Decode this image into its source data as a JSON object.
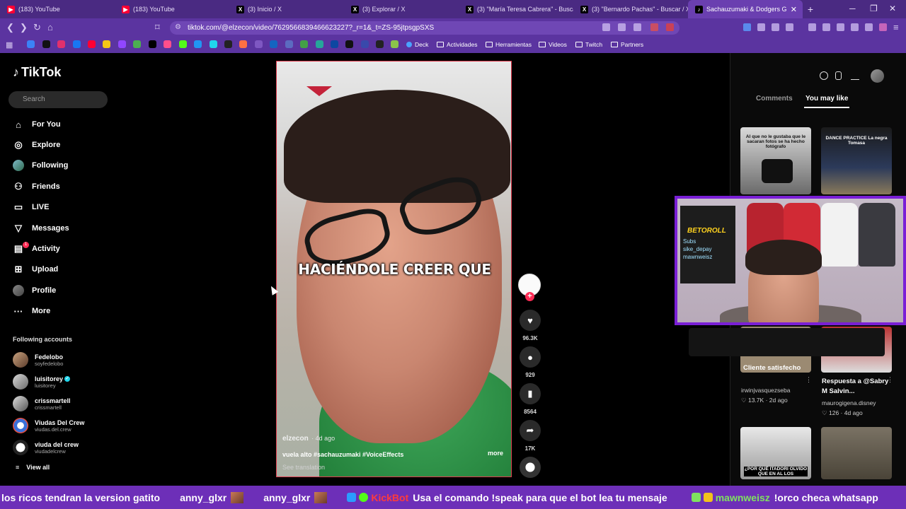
{
  "browser": {
    "tabs": [
      {
        "label": "(183) YouTube",
        "icon": "youtube-icon"
      },
      {
        "label": "(183) YouTube",
        "icon": "youtube-icon"
      },
      {
        "label": "(3) Inicio / X",
        "icon": "x-icon"
      },
      {
        "label": "(3) Explorar / X",
        "icon": "x-icon"
      },
      {
        "label": "(3) \"María Teresa Cabrera\" - Buscar /",
        "icon": "x-icon"
      },
      {
        "label": "(3) \"Bernardo Pachas\" - Buscar / X",
        "icon": "x-icon"
      },
      {
        "label": "Sachauzumaki & Dodgers G",
        "icon": "tiktok-icon"
      }
    ],
    "url": "tiktok.com/@elzecon/video/7629566839466623227?_r=1&_t=ZS-95jtpsgpSXS",
    "bookmarks": [
      "Deck",
      "Actividades",
      "Herramientas",
      "Videos",
      "Twitch",
      "Partners"
    ],
    "colors": {
      "chrome": "#5b34a0",
      "tabbar": "#4a2a82"
    }
  },
  "tiktok": {
    "brand": "TikTok",
    "search_placeholder": "Search",
    "nav": [
      {
        "label": "For You",
        "icon": "home-icon"
      },
      {
        "label": "Explore",
        "icon": "compass-icon"
      },
      {
        "label": "Following",
        "icon": "avatar-icon"
      },
      {
        "label": "Friends",
        "icon": "friends-icon"
      },
      {
        "label": "LIVE",
        "icon": "live-icon"
      },
      {
        "label": "Messages",
        "icon": "messages-icon"
      },
      {
        "label": "Activity",
        "icon": "activity-icon"
      },
      {
        "label": "Upload",
        "icon": "upload-icon"
      },
      {
        "label": "Profile",
        "icon": "profile-icon"
      },
      {
        "label": "More",
        "icon": "more-icon"
      }
    ],
    "activity_badge": "1",
    "following_title": "Following accounts",
    "following": [
      {
        "name": "Fedelobo",
        "handle": "soyfedelobo",
        "verified": false
      },
      {
        "name": "luisitorey",
        "handle": "luisitorey",
        "verified": true
      },
      {
        "name": "crissmartell",
        "handle": "crissmartell",
        "verified": false
      },
      {
        "name": "Viudas Del Crew",
        "handle": "viudas.del.crew",
        "verified": false
      },
      {
        "name": "viuda del crew",
        "handle": "viudadelcrew",
        "verified": false
      }
    ],
    "view_all": "View all",
    "video": {
      "overlay_text": "HACIÉNDOLE CREER QUE",
      "author": "elzecon",
      "age": "· 4d ago",
      "description": "vuela alto #sachauzumaki #VoiceEffects",
      "more": "more",
      "translation": "See translation"
    },
    "actions": {
      "likes": "96.3K",
      "comments": "929",
      "saves": "8564",
      "shares": "17K"
    },
    "panel": {
      "tab_comments": "Comments",
      "tab_like": "You may like",
      "thumb_texts": [
        "Al que no le gustaba que le sacaran fotos se ha hecho fotógrafo",
        "DANCE PRACTICE La negra Tomasa",
        "¿POR QUÉ ITADORI OLVIDO QUE EN AL LOS"
      ],
      "recs": [
        {
          "title": "Cliente satisfecho",
          "user": "irwinjvasquezseba",
          "likes": "13.7K",
          "age": "2d ago"
        },
        {
          "title": "Respuesta a @Sabry M Salvin...",
          "user": "maurogigena.disney",
          "likes": "126",
          "age": "4d ago"
        }
      ]
    }
  },
  "stream": {
    "cam_sign": "BETOROLL",
    "cam_board": "Subs\nsike_depay\nmawnweisz",
    "ticker": [
      {
        "type": "msg",
        "text": "los ricos tendran la version gatito"
      },
      {
        "type": "user",
        "name": "anny_glxr",
        "color": "#ffffff"
      },
      {
        "type": "user",
        "name": "anny_glxr",
        "color": "#ffffff"
      },
      {
        "type": "user",
        "name": "KickBot",
        "color": "#ff3b3b"
      },
      {
        "type": "msg",
        "text": "Usa el comando !speak para que el bot lea tu mensaje"
      },
      {
        "type": "user",
        "name": "mawnweisz",
        "color": "#7fe35f"
      },
      {
        "type": "msg",
        "text": "!orco checa whatsapp"
      }
    ],
    "colors": {
      "ticker": "#6d2fb8",
      "cam_border": "#7a1fd6"
    }
  }
}
